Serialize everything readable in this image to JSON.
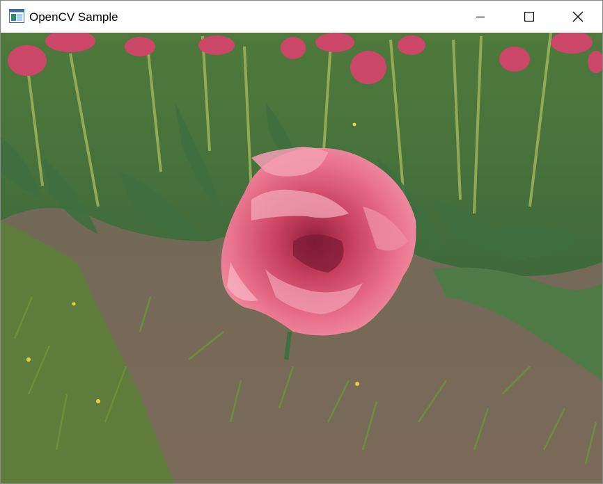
{
  "window": {
    "title": "OpenCV Sample",
    "icon": "app-window-icon",
    "controls": {
      "minimize_icon": "minimize-icon",
      "maximize_icon": "maximize-icon",
      "close_icon": "close-icon"
    }
  },
  "image": {
    "subject": "pink-tulip-photo"
  },
  "colors": {
    "titlebar_bg": "#ffffff",
    "title_text": "#000000",
    "window_border": "#8a8a8a"
  }
}
